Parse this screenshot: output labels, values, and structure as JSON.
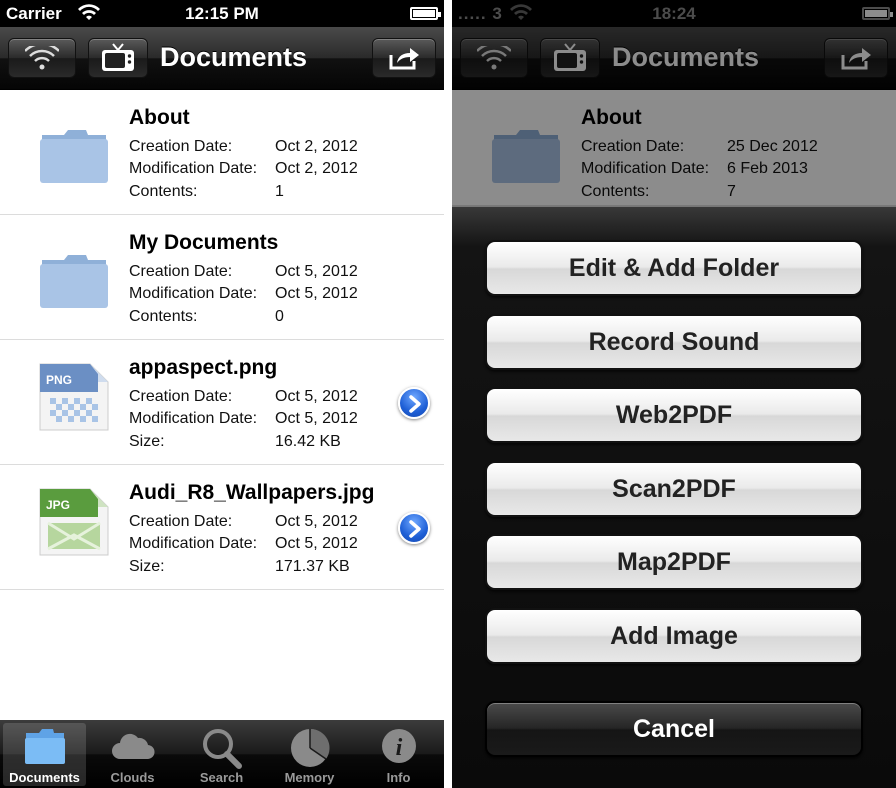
{
  "left": {
    "status": {
      "carrier": "Carrier",
      "time": "12:15 PM"
    },
    "nav": {
      "title": "Documents",
      "wifi_icon": "wifi-icon",
      "tv_icon": "tv-icon",
      "share_icon": "share-icon"
    },
    "documents": [
      {
        "name": "About",
        "type": "folder",
        "l1": "Creation Date:",
        "v1": "Oct 2, 2012",
        "l2": "Modification Date:",
        "v2": "Oct 2, 2012",
        "l3": "Contents:",
        "v3": "1"
      },
      {
        "name": "My Documents",
        "type": "folder",
        "l1": "Creation Date:",
        "v1": "Oct 5, 2012",
        "l2": "Modification Date:",
        "v2": "Oct 5, 2012",
        "l3": "Contents:",
        "v3": "0"
      },
      {
        "name": "appaspect.png",
        "type": "png",
        "badge": "PNG",
        "l1": "Creation Date:",
        "v1": "Oct 5, 2012",
        "l2": "Modification Date:",
        "v2": "Oct 5, 2012",
        "l3": "Size:",
        "v3": "16.42 KB"
      },
      {
        "name": "Audi_R8_Wallpapers.jpg",
        "type": "jpg",
        "badge": "JPG",
        "l1": "Creation Date:",
        "v1": "Oct 5, 2012",
        "l2": "Modification Date:",
        "v2": "Oct 5, 2012",
        "l3": "Size:",
        "v3": "171.37 KB"
      }
    ],
    "tabs": [
      {
        "label": "Documents",
        "icon": "folder-icon",
        "active": true
      },
      {
        "label": "Clouds",
        "icon": "cloud-icon",
        "active": false
      },
      {
        "label": "Search",
        "icon": "search-icon",
        "active": false
      },
      {
        "label": "Memory",
        "icon": "pie-chart-icon",
        "active": false
      },
      {
        "label": "Info",
        "icon": "info-icon",
        "active": false
      }
    ]
  },
  "right": {
    "status": {
      "signal": "..... 3",
      "time": "18:24"
    },
    "nav": {
      "title": "Documents"
    },
    "document": {
      "name": "About",
      "l1": "Creation Date:",
      "v1": "25 Dec 2012",
      "l2": "Modification Date:",
      "v2": "6 Feb 2013",
      "l3": "Contents:",
      "v3": "7"
    },
    "actions": [
      "Edit & Add Folder",
      "Record Sound",
      "Web2PDF",
      "Scan2PDF",
      "Map2PDF",
      "Add Image"
    ],
    "cancel": "Cancel"
  },
  "colors": {
    "accent_blue": "#1e5fd6",
    "bar_dark": "#111111",
    "folder_blue": "#a9c4e6"
  }
}
